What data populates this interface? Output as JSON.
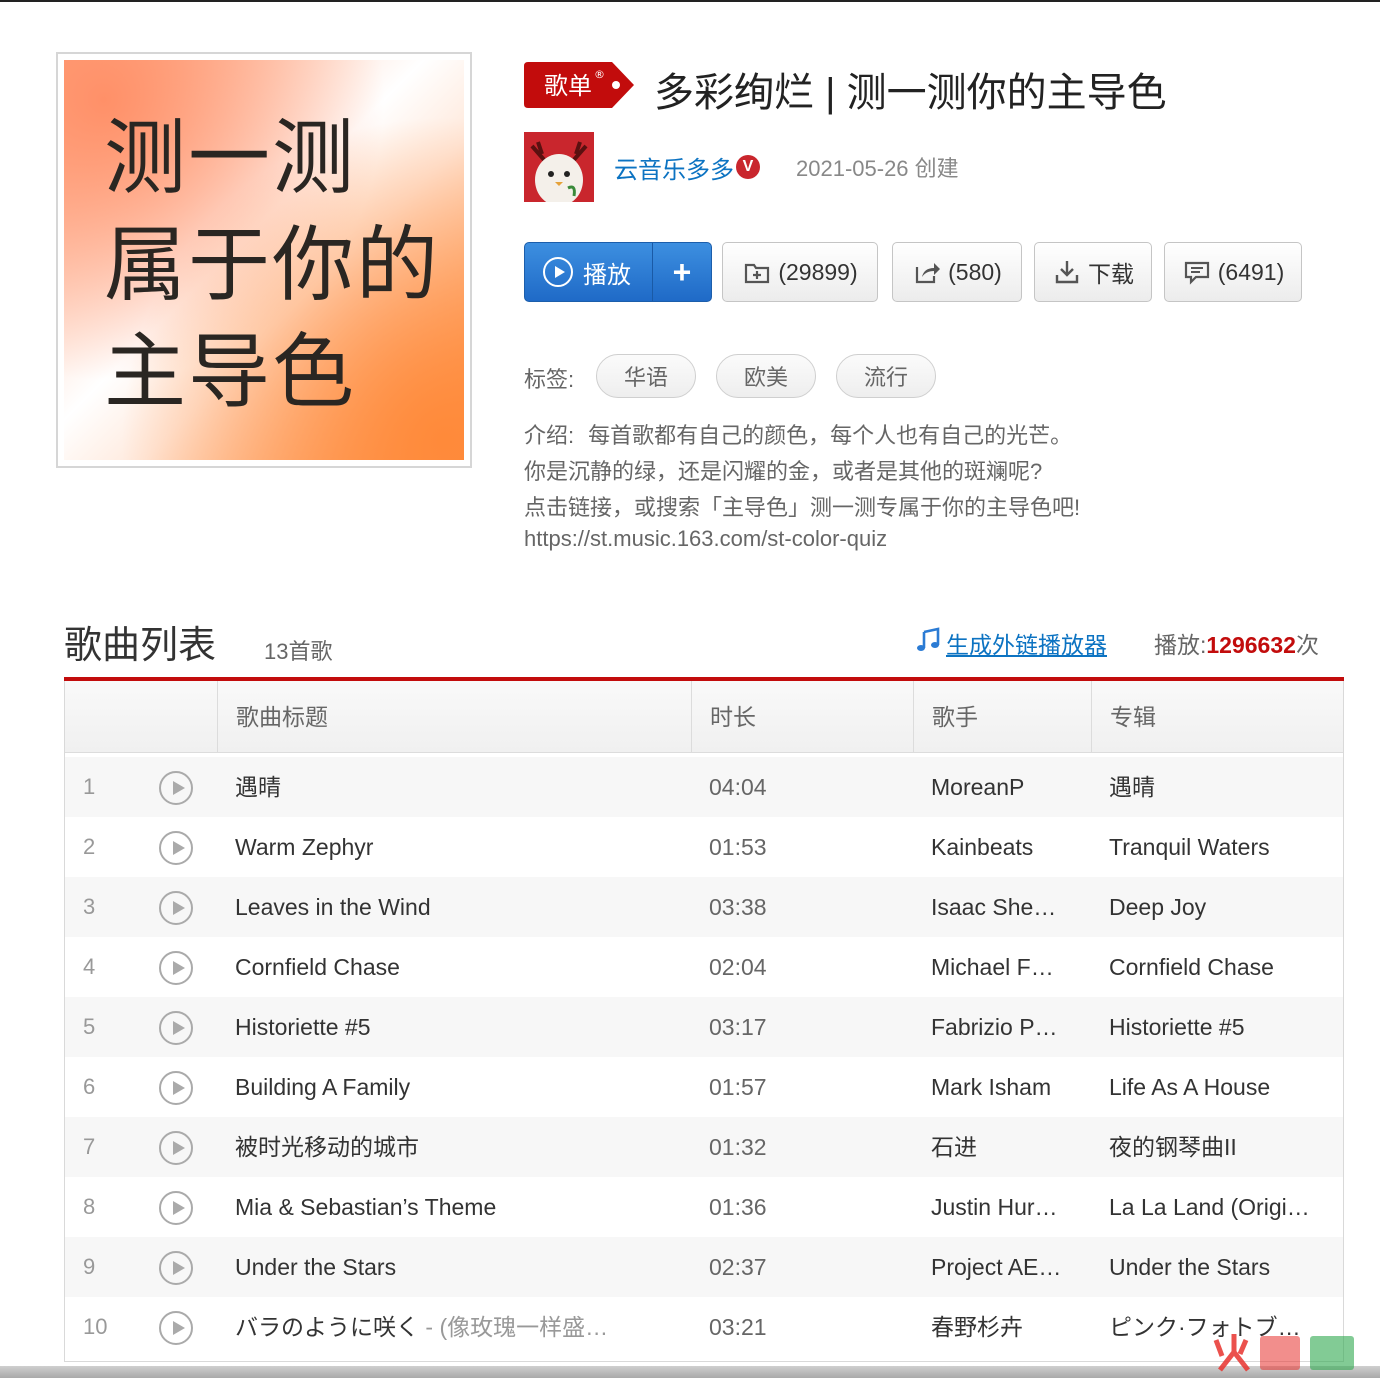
{
  "cover": {
    "line1": "测一测",
    "line2": "属于你的",
    "line3": "主导色"
  },
  "header": {
    "badge": "歌单",
    "title": "多彩绚烂 | 测一测你的主导色",
    "creator": "云音乐多多",
    "vip": "V",
    "created": "2021-05-26 创建"
  },
  "buttons": {
    "play": "播放",
    "add": "+",
    "collect": "(29899)",
    "share": "(580)",
    "download": "下载",
    "comment": "(6491)"
  },
  "tags": {
    "label": "标签:",
    "items": [
      "华语",
      "欧美",
      "流行"
    ]
  },
  "description": {
    "label": "介绍:",
    "line1": "每首歌都有自己的颜色，每个人也有自己的光芒。",
    "line2": "你是沉静的绿，还是闪耀的金，或者是其他的斑斓呢?",
    "line3": "点击链接，或搜索「主导色」测一测专属于你的主导色吧!",
    "line4": "https://st.music.163.com/st-color-quiz"
  },
  "song_list": {
    "title": "歌曲列表",
    "count": "13首歌",
    "embed_link": "生成外链播放器",
    "plays_label": "播放:",
    "plays_count": "1296632",
    "plays_unit": "次",
    "columns": [
      "歌曲标题",
      "时长",
      "歌手",
      "专辑"
    ],
    "rows": [
      {
        "idx": "1",
        "title": "遇晴",
        "alias": "",
        "duration": "04:04",
        "artist": "MoreanP",
        "album": "遇晴"
      },
      {
        "idx": "2",
        "title": "Warm Zephyr",
        "alias": "",
        "duration": "01:53",
        "artist": "Kainbeats",
        "album": "Tranquil Waters"
      },
      {
        "idx": "3",
        "title": "Leaves in the Wind",
        "alias": "",
        "duration": "03:38",
        "artist": "Isaac She…",
        "album": "Deep Joy"
      },
      {
        "idx": "4",
        "title": "Cornfield Chase",
        "alias": "",
        "duration": "02:04",
        "artist": "Michael F…",
        "album": "Cornfield Chase"
      },
      {
        "idx": "5",
        "title": "Historiette #5",
        "alias": "",
        "duration": "03:17",
        "artist": "Fabrizio P…",
        "album": "Historiette #5"
      },
      {
        "idx": "6",
        "title": "Building A Family",
        "alias": "",
        "duration": "01:57",
        "artist": "Mark Isham",
        "album": "Life As A House"
      },
      {
        "idx": "7",
        "title": "被时光移动的城市",
        "alias": "",
        "duration": "01:32",
        "artist": "石进",
        "album": "夜的钢琴曲II"
      },
      {
        "idx": "8",
        "title": "Mia & Sebastian’s Theme",
        "alias": "",
        "duration": "01:36",
        "artist": "Justin Hur…",
        "album": "La La Land (Origi…"
      },
      {
        "idx": "9",
        "title": "Under the Stars",
        "alias": "",
        "duration": "02:37",
        "artist": "Project AE…",
        "album": "Under the Stars"
      },
      {
        "idx": "10",
        "title": "バラのように咲く",
        "alias": " - (像玫瑰一样盛…",
        "duration": "03:21",
        "artist": "春野杉卉",
        "album": "ピンク·フォトブ…"
      }
    ]
  },
  "colors": {
    "accent_red": "#c20c0c",
    "link_blue": "#0c73c2",
    "play_blue": "#2b7bd4"
  }
}
